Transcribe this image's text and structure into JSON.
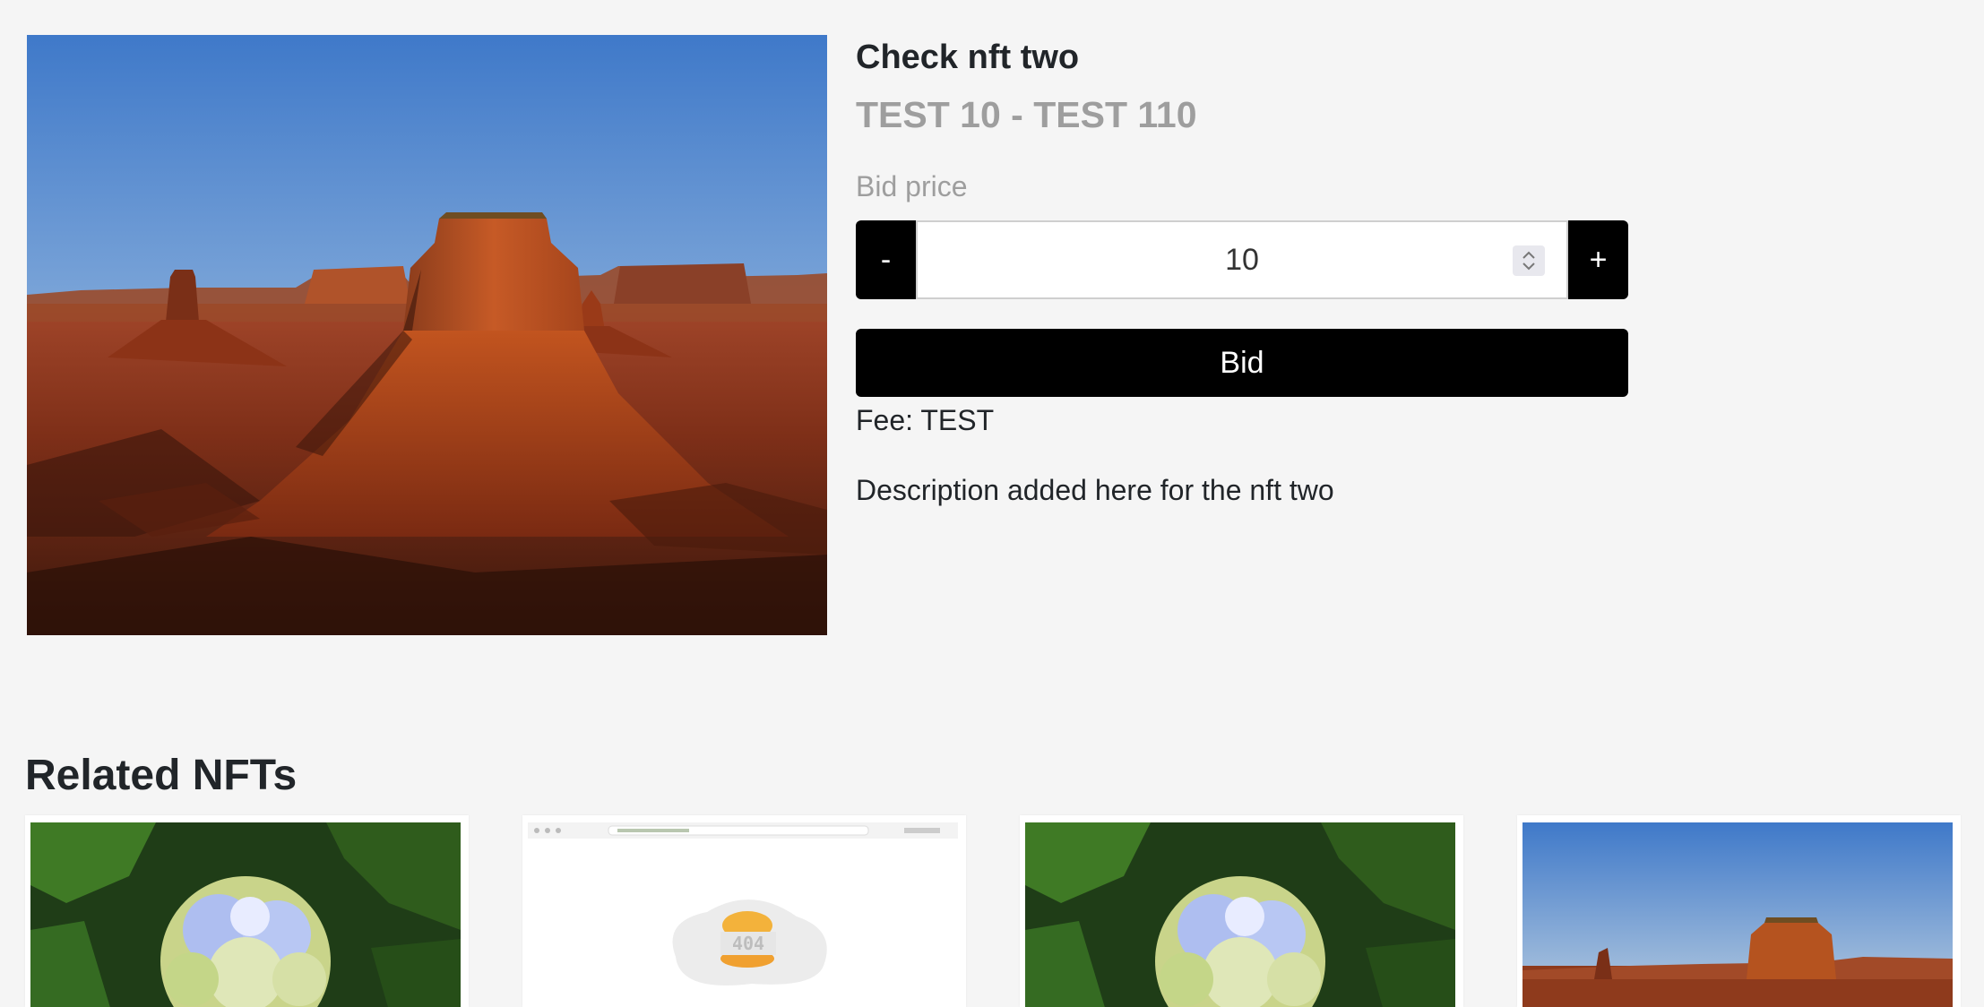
{
  "product": {
    "title": "Check nft two",
    "price_range": "TEST 10 - TEST 110",
    "bid_label": "Bid price",
    "bid_value": "10",
    "decrement_label": "-",
    "increment_label": "+",
    "bid_button": "Bid",
    "fee": "Fee: TEST",
    "description": "Description added here for the nft two"
  },
  "related": {
    "title": "Related NFTs",
    "cards": [
      {
        "image": "hydrangea-flower-image"
      },
      {
        "image": "404-error-screenshot-image"
      },
      {
        "image": "hydrangea-flower-image"
      },
      {
        "image": "desert-butte-image"
      }
    ]
  },
  "colors": {
    "background": "#f5f5f5",
    "primary_button": "#000000",
    "muted_text": "#9e9e9e"
  }
}
